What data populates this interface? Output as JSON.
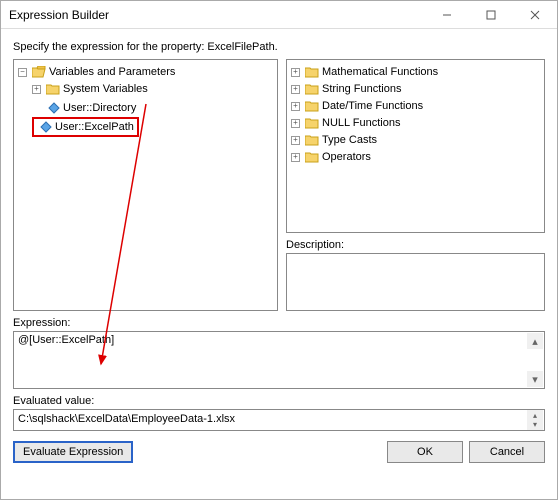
{
  "window": {
    "title": "Expression Builder"
  },
  "instruction": "Specify the expression for the property: ExcelFilePath.",
  "left_tree": {
    "root": "Variables and Parameters",
    "items": [
      {
        "label": "System Variables",
        "type": "folder"
      },
      {
        "label": "User::Directory",
        "type": "var"
      },
      {
        "label": "User::ExcelPath",
        "type": "var",
        "highlighted": true
      }
    ]
  },
  "right_tree": {
    "items": [
      "Mathematical Functions",
      "String Functions",
      "Date/Time Functions",
      "NULL Functions",
      "Type Casts",
      "Operators"
    ]
  },
  "labels": {
    "description": "Description:",
    "expression": "Expression:",
    "evaluated": "Evaluated value:"
  },
  "expression": {
    "value": "@[User::ExcelPath]"
  },
  "evaluated": {
    "value": "C:\\sqlshack\\ExcelData\\EmployeeData-1.xlsx"
  },
  "buttons": {
    "evaluate": "Evaluate Expression",
    "ok": "OK",
    "cancel": "Cancel"
  }
}
